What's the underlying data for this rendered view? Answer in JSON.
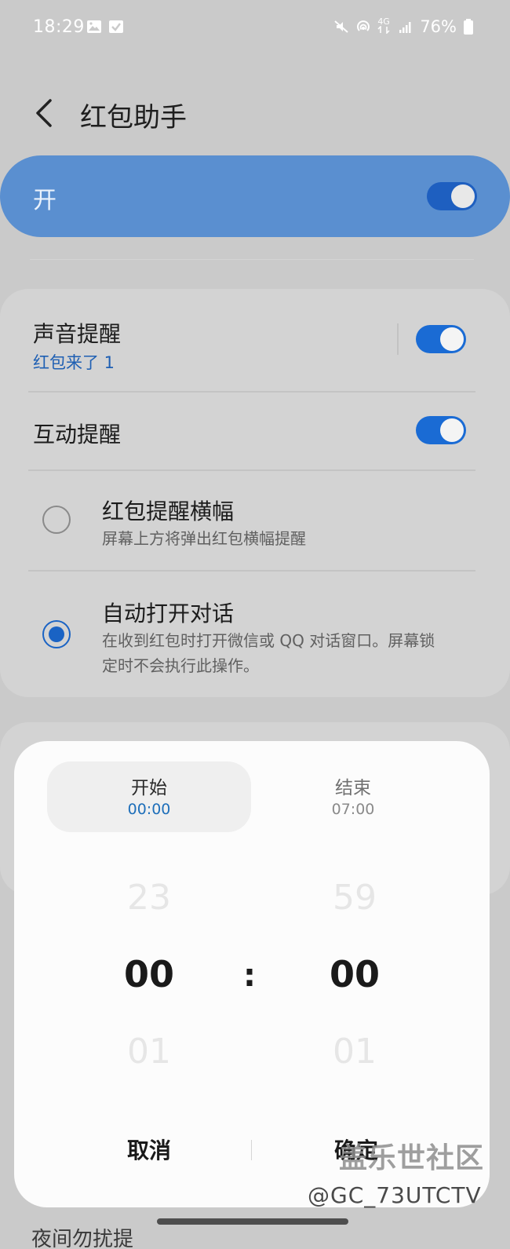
{
  "status_bar": {
    "time": "18:29",
    "battery_percent": "76%",
    "network_label": "4G",
    "left_icons": [
      "gallery-icon",
      "check-icon"
    ],
    "right_icons": [
      "mute-icon",
      "hotspot-icon",
      "data-arrows-icon",
      "signal-icon",
      "battery-icon"
    ]
  },
  "header": {
    "title": "红包助手",
    "back_icon": "back-chevron-icon"
  },
  "master_switch": {
    "label": "开",
    "on": true
  },
  "settings": {
    "sound_reminder": {
      "title": "声音提醒",
      "subtitle": "红包来了 1",
      "on": true
    },
    "interactive_reminder": {
      "title": "互动提醒",
      "on": true
    },
    "banner_option": {
      "title": "红包提醒横幅",
      "desc": "屏幕上方将弹出红包横幅提醒",
      "selected": false
    },
    "auto_open_option": {
      "title": "自动打开对话",
      "desc_line1": "在收到红包时打开微信或 QQ 对话窗口。屏幕锁",
      "desc_line2": "定时不会执行此操作。",
      "selected": true
    }
  },
  "time_picker": {
    "start_tab": {
      "label": "开始",
      "time": "00:00",
      "active": true
    },
    "end_tab": {
      "label": "结束",
      "time": "07:00",
      "active": false
    },
    "hours": {
      "prev": "23",
      "current": "00",
      "next": "01"
    },
    "minutes": {
      "prev": "59",
      "current": "00",
      "next": "01"
    },
    "separator": ":",
    "cancel_label": "取消",
    "confirm_label": "确定"
  },
  "watermark": {
    "title": "盖乐世社区",
    "user": "@GC_73UTCTV"
  },
  "below_peek_text": "夜间勿扰提"
}
